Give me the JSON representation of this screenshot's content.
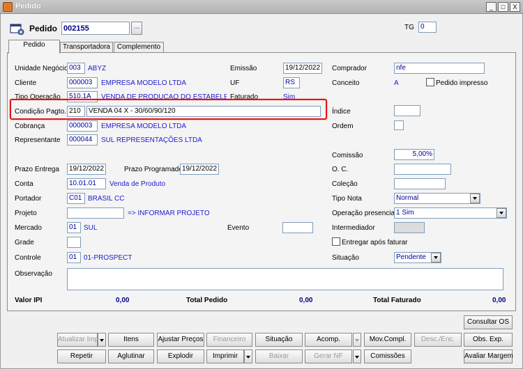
{
  "window": {
    "title": "Pedido",
    "btn_min": "_",
    "btn_max": "□",
    "btn_close": "X"
  },
  "header": {
    "label": "Pedido",
    "number": "002155",
    "lookup": "...",
    "tg_label": "TG",
    "tg_value": "0"
  },
  "tabs": [
    "Pedido",
    "Transportadora",
    "Complemento"
  ],
  "form": {
    "unidade_label": "Unidade Negócio",
    "unidade_code": "003",
    "unidade_name": "ABYZ",
    "cliente_label": "Cliente",
    "cliente_code": "000003",
    "cliente_name": "EMPRESA MODELO LTDA",
    "tipo_op_label": "Tipo Operação",
    "tipo_op_code": "510.1A",
    "tipo_op_name": "VENDA DE PRODUCAO DO ESTABELECIMEI",
    "cond_label": "Condição Pagto.",
    "cond_code": "210",
    "cond_name": "VENDA 04 X - 30/60/90/120",
    "cobranca_label": "Cobrança",
    "cobranca_code": "000003",
    "cobranca_name": "EMPRESA MODELO LTDA",
    "repr_label": "Representante",
    "repr_code": "000044",
    "repr_name": "SUL REPRESENTAÇÕES LTDA",
    "emissao_label": "Emissão",
    "emissao_value": "19/12/2022",
    "uf_label": "UF",
    "uf_value": "RS",
    "faturado_label": "Faturado",
    "faturado_value": "Sim",
    "comprador_label": "Comprador",
    "comprador_value": "nfe",
    "conceito_label": "Conceito",
    "conceito_value": "A",
    "pedido_impresso_label": "Pedido impresso",
    "indice_label": "Índice",
    "ordem_label": "Ordem",
    "comissao_label": "Comissão",
    "comissao_value": "5,00%",
    "prazo_entrega_label": "Prazo Entrega",
    "prazo_entrega_value": "19/12/2022",
    "prazo_prog_label": "Prazo Programado",
    "prazo_prog_value": "19/12/2022",
    "oc_label": "O. C.",
    "colecao_label": "Coleção",
    "conta_label": "Conta",
    "conta_code": "10.01.01",
    "conta_name": "Venda de Produto",
    "portador_label": "Portador",
    "portador_code": "C01",
    "portador_name": "BRASIL CC",
    "tipo_nota_label": "Tipo Nota",
    "tipo_nota_value": "Normal",
    "projeto_label": "Projeto",
    "projeto_hint": "=> INFORMAR PROJETO",
    "op_presencial_label": "Operação presencial",
    "op_presencial_value": "1 Sim",
    "mercado_label": "Mercado",
    "mercado_code": "01",
    "mercado_name": "SUL",
    "evento_label": "Evento",
    "intermediador_label": "Intermediador",
    "grade_label": "Grade",
    "entregar_label": "Entregar após faturar",
    "controle_label": "Controle",
    "controle_code": "01",
    "controle_name": "01-PROSPECT",
    "situacao_label": "Situação",
    "situacao_value": "Pendente",
    "observacao_label": "Observação"
  },
  "totals": {
    "ipi_label": "Valor IPI",
    "ipi_value": "0,00",
    "pedido_label": "Total Pedido",
    "pedido_value": "0,00",
    "faturado_label": "Total Faturado",
    "faturado_value": "0,00"
  },
  "buttons": {
    "consultar_os": "Consultar OS",
    "atualizar_imp": "Atualizar Imp",
    "itens": "Itens",
    "ajustar_precos": "Ajustar Preços",
    "financeiro": "Financeiro",
    "situacao": "Situação",
    "acomp": "Acomp.",
    "mov_compl": "Mov.Compl.",
    "desc_enc": "Desc./Enc.",
    "obs_exp": "Obs. Exp.",
    "repetir": "Repetir",
    "aglutinar": "Aglutinar",
    "explodir": "Explodir",
    "imprimir": "Imprimir",
    "baixar": "Baixar",
    "gerar_nf": "Gerar NF",
    "comissoes": "Comissões",
    "avaliar_margem": "Avaliar Margem"
  }
}
